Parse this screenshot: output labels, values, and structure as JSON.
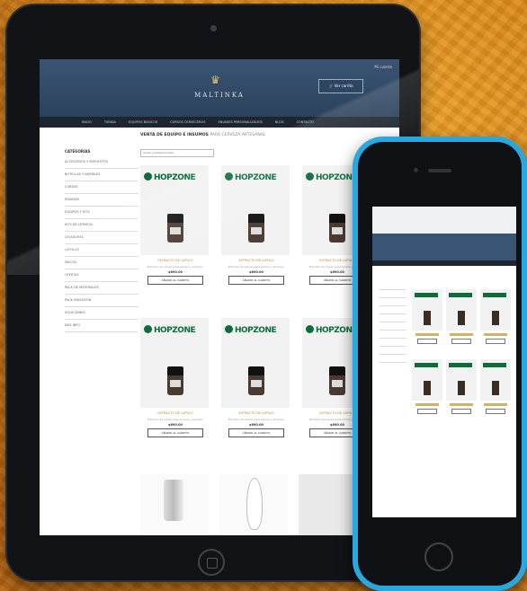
{
  "store": {
    "logo_text": "MALTINKA",
    "topright": "Mi cuenta",
    "cart_label": "Ver carrito"
  },
  "nav": [
    "INICIO",
    "TIENDA",
    "EQUIPOS BASICOS",
    "CURSOS CERVECEROS",
    "ENVASES PERSONALIZADOS",
    "BLOG",
    "CONTACTO"
  ],
  "sidebar": {
    "title": "CATEGORIAS",
    "items": [
      "ACCESORIOS Y REPUESTOS",
      "BOTELLAS Y BARRILES",
      "CURSOS",
      "ENVASES",
      "EQUIPOS Y KITS",
      "KITS DE CERVEZA",
      "LEVADURAS",
      "LUPULOS",
      "MALTAS",
      "OFERTAS",
      "PACK DE MATERIALES",
      "PACK INICIACION",
      "SOLUCIONES",
      "MAS INFO"
    ]
  },
  "main": {
    "title": "VENTA DE EQUIPO E INSUMOS",
    "title_sub": "PARA CERVEZA ARTESANAL",
    "sort_placeholder": "Orden predeterminado"
  },
  "products": [
    {
      "brand": "HOPZONE",
      "name": "EXTRACTO DE LÚPULO",
      "desc": "Extracto de lúpulo para aroma y amargor",
      "price": "$690.00",
      "button": "AÑADIR AL CARRITO"
    },
    {
      "brand": "HOPZONE",
      "name": "EXTRACTO DE LÚPULO",
      "desc": "Extracto de lúpulo para aroma y amargor",
      "price": "$690.00",
      "button": "AÑADIR AL CARRITO"
    },
    {
      "brand": "HOPZONE",
      "name": "EXTRACTO DE LÚPULO",
      "desc": "Extracto de lúpulo para aroma y amargor",
      "price": "$690.00",
      "button": "AÑADIR AL CARRITO"
    },
    {
      "brand": "HOPZONE",
      "name": "EXTRACTO DE LÚPULO",
      "desc": "Extracto de lúpulo para aroma y amargor",
      "price": "$690.00",
      "button": "AÑADIR AL CARRITO"
    },
    {
      "brand": "HOPZONE",
      "name": "EXTRACTO DE LÚPULO",
      "desc": "Extracto de lúpulo para aroma y amargor",
      "price": "$690.00",
      "button": "AÑADIR AL CARRITO"
    },
    {
      "brand": "HOPZONE",
      "name": "EXTRACTO DE LÚPULO",
      "desc": "Extracto de lúpulo para aroma y amargor",
      "price": "$690.00",
      "button": "AÑADIR AL CARRITO"
    }
  ],
  "colors": {
    "header": "#3a5473",
    "nav": "#1d2530",
    "accent": "#b88a2c",
    "brand_green": "#0e6b3a",
    "phone_case": "#29a8df",
    "background": "#d9861a"
  },
  "icons": [
    "logo-mark-icon",
    "cart-icon",
    "home-button-icon"
  ]
}
